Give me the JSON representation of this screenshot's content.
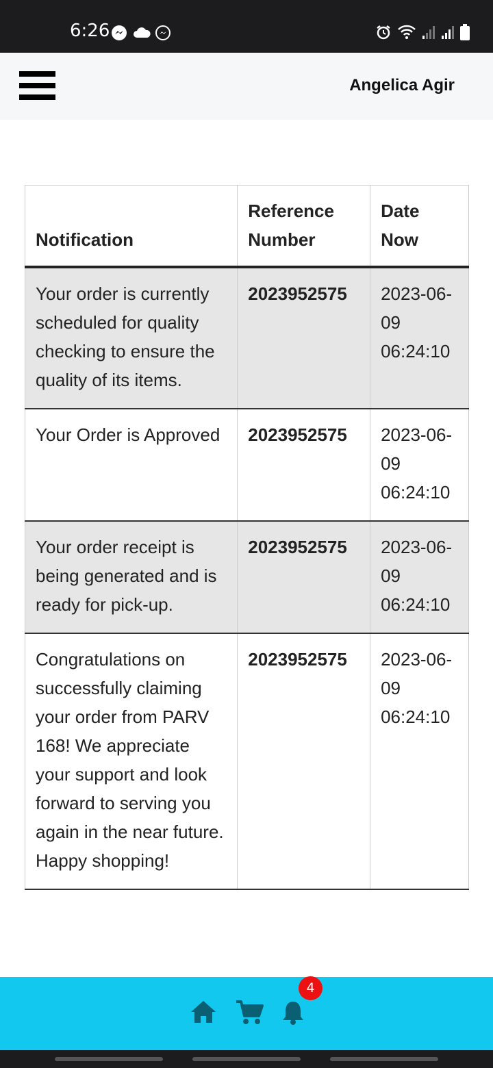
{
  "status_bar": {
    "time": "6:26",
    "left_icons": [
      "messenger-icon",
      "cloud-icon",
      "messenger-outline-icon"
    ],
    "right_icons": [
      "alarm-icon",
      "wifi-icon",
      "signal-icon",
      "signal-icon",
      "battery-icon"
    ]
  },
  "header": {
    "menu_icon": "hamburger-icon",
    "user_name": "Angelica Agir"
  },
  "table": {
    "columns": [
      "Notification",
      "Reference Number",
      "Date Now"
    ],
    "header_lines": {
      "reference": [
        "Reference",
        "Number"
      ],
      "date": [
        "Date",
        "Now"
      ]
    },
    "rows": [
      {
        "notification": "Your order is currently scheduled for quality checking to ensure the quality of its items.",
        "reference": "2023952575",
        "date": [
          "2023-06-",
          "09",
          "06:24:10"
        ]
      },
      {
        "notification": "Your Order is Approved",
        "reference": "2023952575",
        "date": [
          "2023-06-",
          "09",
          "06:24:10"
        ]
      },
      {
        "notification": "Your order receipt is being generated and is ready for pick-up.",
        "reference": "2023952575",
        "date": [
          "2023-06-",
          "09",
          "06:24:10"
        ]
      },
      {
        "notification": "Congratulations on successfully claiming your order from PARV 168! We appreciate your support and look forward to serving you again in the near future. Happy shopping!",
        "reference": "2023952575",
        "date": [
          "2023-06-",
          "09",
          "06:24:10"
        ]
      }
    ]
  },
  "bottom_nav": {
    "items": [
      "home-icon",
      "cart-icon",
      "bell-icon"
    ],
    "notification_count": "4"
  },
  "colors": {
    "bottom_nav": "#12c8ef",
    "nav_icons": "#0a5f73",
    "badge": "#ee1111",
    "row_shade": "#e6e6e6",
    "header_bg": "#f6f7f9"
  }
}
